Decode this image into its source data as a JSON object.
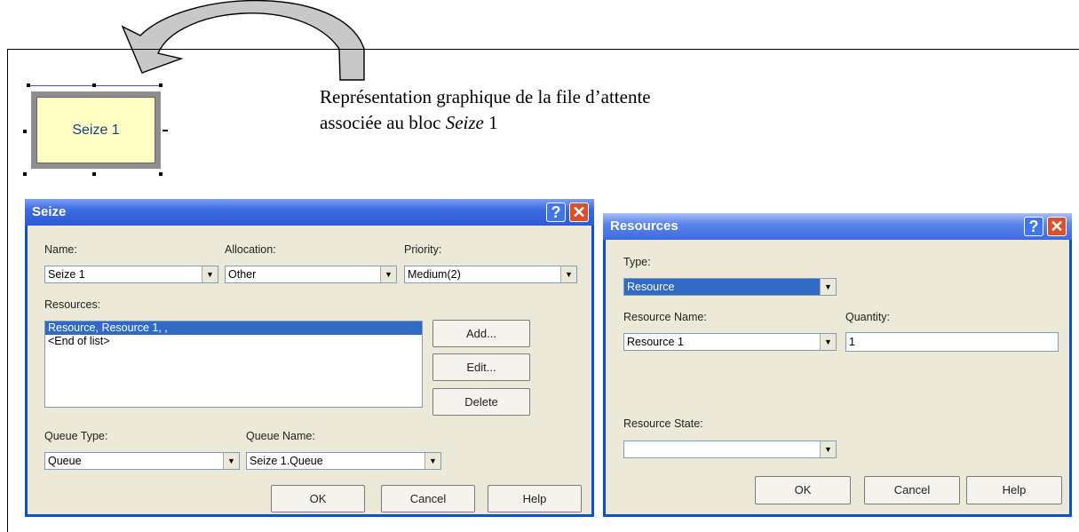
{
  "caption": {
    "line1": "Représentation graphique de la file d’attente",
    "line2_prefix": "associée au bloc ",
    "line2_italic": "Seize",
    "line2_suffix": " 1"
  },
  "module": {
    "label": "Seize 1"
  },
  "seize_dialog": {
    "title": "Seize",
    "name_label": "Name:",
    "name_value": "Seize 1",
    "allocation_label": "Allocation:",
    "allocation_value": "Other",
    "priority_label": "Priority:",
    "priority_value": "Medium(2)",
    "resources_label": "Resources:",
    "resources_items": [
      "Resource, Resource 1, ,",
      "<End of list>"
    ],
    "add_label": "Add...",
    "edit_label": "Edit...",
    "delete_label": "Delete",
    "queue_type_label": "Queue Type:",
    "queue_type_value": "Queue",
    "queue_name_label": "Queue Name:",
    "queue_name_value": "Seize 1.Queue",
    "ok_label": "OK",
    "cancel_label": "Cancel",
    "help_label": "Help"
  },
  "resources_dialog": {
    "title": "Resources",
    "type_label": "Type:",
    "type_value": "Resource",
    "resource_name_label": "Resource Name:",
    "resource_name_value": "Resource 1",
    "quantity_label": "Quantity:",
    "quantity_value": "1",
    "resource_state_label": "Resource State:",
    "resource_state_value": "",
    "ok_label": "OK",
    "cancel_label": "Cancel",
    "help_label": "Help"
  }
}
